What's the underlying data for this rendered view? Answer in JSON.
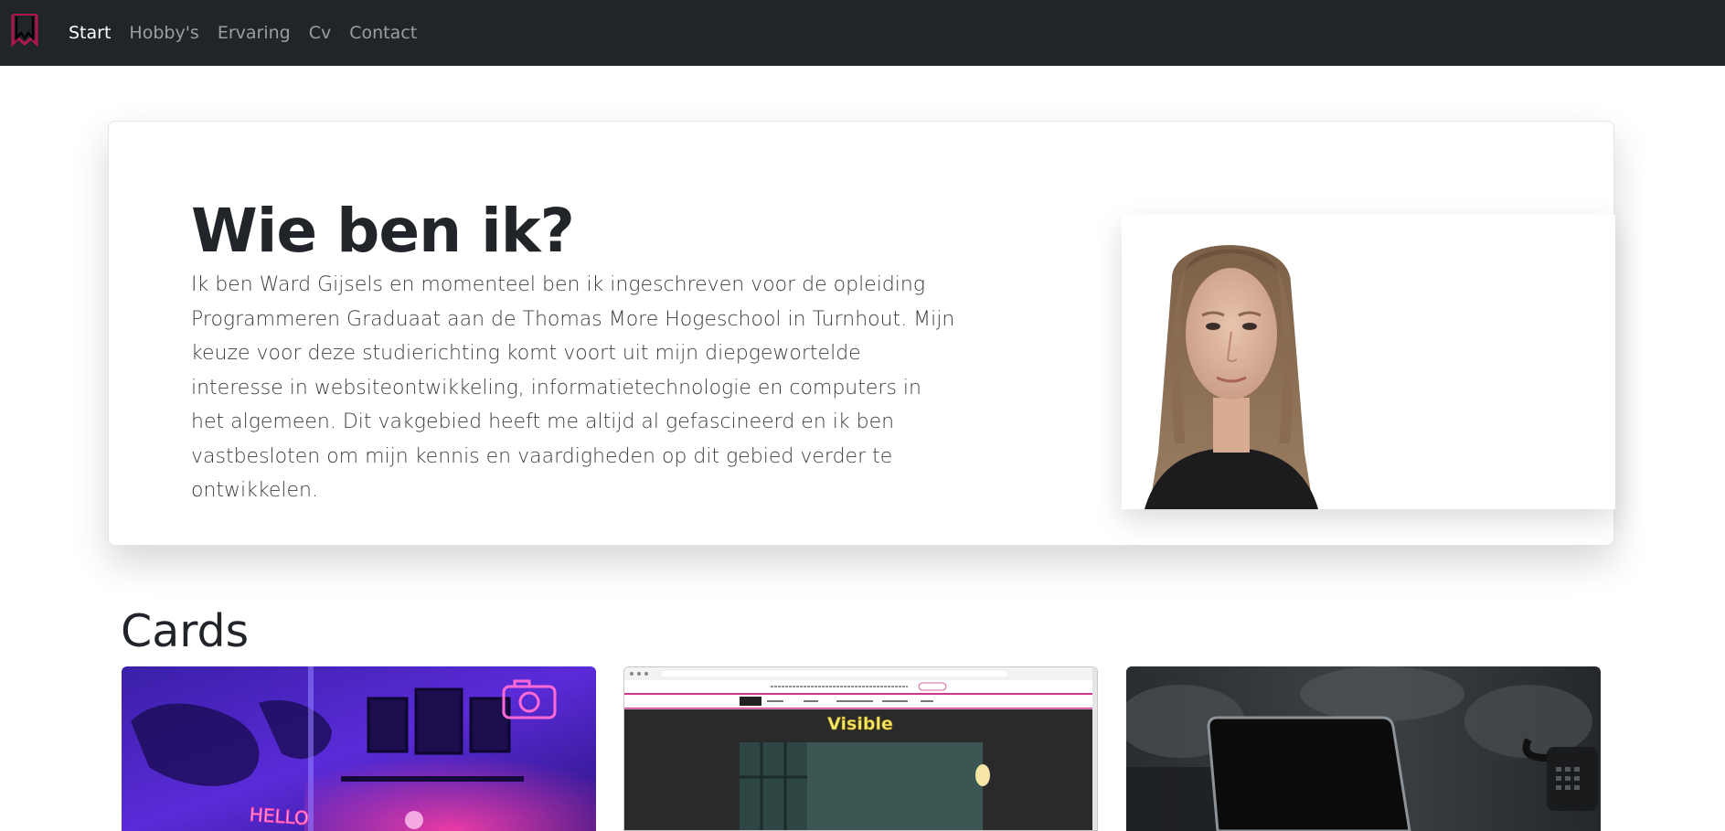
{
  "navbar": {
    "brand_icon": "w-logo-icon",
    "links": [
      "Start",
      "Hobby's",
      "Ervaring",
      "Cv",
      "Contact"
    ],
    "active": "Start"
  },
  "hero": {
    "title": "Wie ben ik?",
    "text": "Ik ben Ward Gijsels en momenteel ben ik ingeschreven voor de opleiding Programmeren Graduaat aan de Thomas More Hogeschool in Turnhout. Mijn keuze voor deze studierichting komt voort uit mijn diepgewortelde interesse in websiteontwikkeling, informatietechnologie en computers in het algemeen. Dit vakgebied heeft me altijd al gefascineerd en ik ben vastbesloten om mijn kennis en vaardigheden op dit gebied verder te ontwikkelen."
  },
  "cards": {
    "title": "Cards",
    "items": [
      {
        "image": "neon-room-photo",
        "neon_sign": "HELLO"
      },
      {
        "image": "website-screenshot",
        "site_logo": "Visible",
        "site_nav": [
          "HOME",
          "OVER ONS",
          "CONTACT",
          "PRODUCTEN · SHOP",
          "DOORMAKEN",
          "SHOP"
        ]
      },
      {
        "image": "laptop-office-photo"
      }
    ]
  },
  "colors": {
    "navbar_bg": "#212529",
    "brand_accent": "#b0164f",
    "page_bg": "#ffffff"
  }
}
